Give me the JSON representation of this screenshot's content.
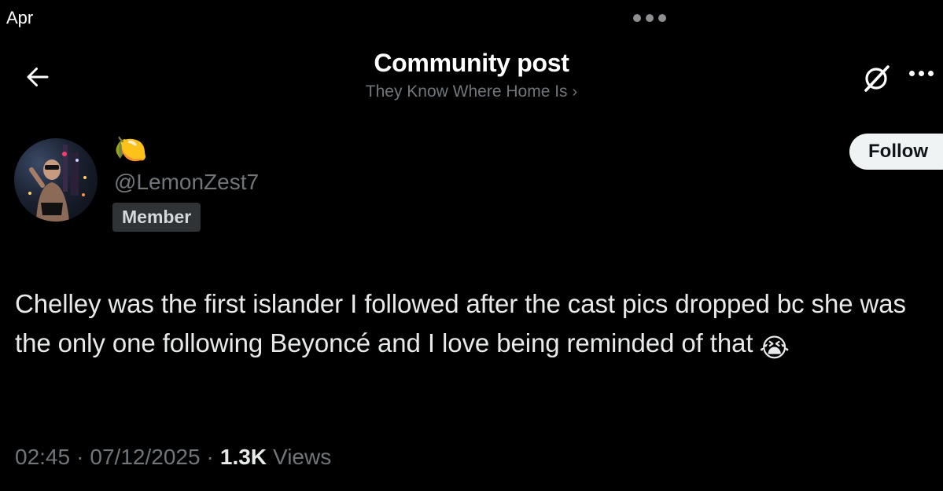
{
  "status_bar": {
    "time": "Apr"
  },
  "header": {
    "title": "Community post",
    "community_name": "They Know Where Home Is",
    "community_chevron": "›"
  },
  "author": {
    "display_name": "🍋",
    "handle": "@LemonZest7",
    "badge": "Member"
  },
  "follow_button": {
    "label": "Follow"
  },
  "post": {
    "text": "Chelley was the first islander I followed after the cast pics dropped bc she was the only one following Beyoncé and I love being reminded of that",
    "emoji": "😭"
  },
  "meta": {
    "time": "02:45",
    "separator": "·",
    "date": "07/12/2025",
    "views_count": "1.3K",
    "views_label": "Views"
  },
  "icons": {
    "back": "arrow-left-icon",
    "grok": "grok-icon",
    "more": "more-horizontal-icon"
  },
  "colors": {
    "background": "#000000",
    "primary_text": "#e7e9ea",
    "secondary_text": "#71767b",
    "badge_bg": "#2f3336",
    "follow_bg": "#eff3f4"
  }
}
